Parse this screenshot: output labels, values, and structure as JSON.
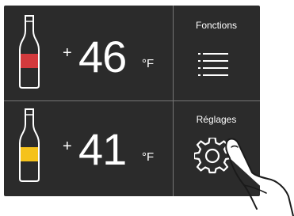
{
  "zones": [
    {
      "plus": "+",
      "temperature": "46",
      "unit": "°F",
      "bottle_color": "#d33a3d"
    },
    {
      "plus": "+",
      "temperature": "41",
      "unit": "°F",
      "bottle_color": "#f5c21b"
    }
  ],
  "tiles": {
    "fonctions_label": "Fonctions",
    "reglages_label": "Réglages"
  },
  "colors": {
    "panel": "#2b2b2b",
    "divider": "#767676",
    "text": "#ffffff"
  },
  "icons": {
    "menu": "menu-icon",
    "settings": "gear-icon",
    "pointer": "hand-pointer-icon",
    "bottle": "wine-bottle-icon"
  }
}
